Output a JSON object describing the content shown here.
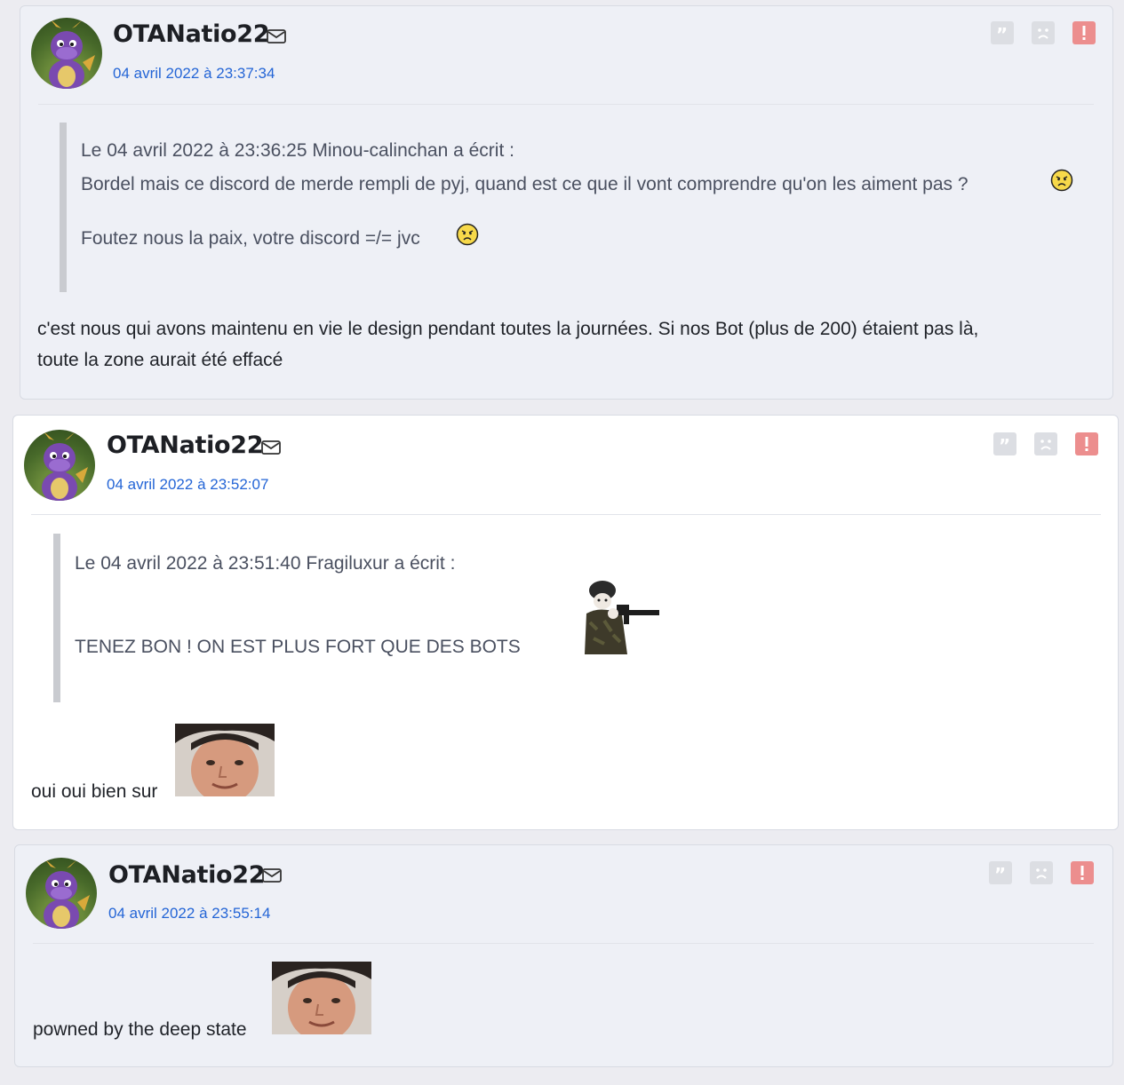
{
  "icons": {
    "mail": "mail-icon",
    "quote": "quote-icon",
    "blacklist": "sad-face-icon",
    "report": "exclamation-icon",
    "avatar": "purple-dragon-avatar",
    "smiley": "angry-smiley-icon",
    "soldier": "soldier-sticker",
    "face": "man-face-sticker"
  },
  "colors": {
    "date_link": "#2465d6",
    "report_red": "#ec8e8e",
    "quote_bar": "#c9cbd0"
  },
  "posts": [
    {
      "author": "OTANatio22",
      "date": "04 avril 2022 à 23:37:34",
      "quote": {
        "header": "Le 04 avril 2022 à 23:36:25 Minou-calinchan a écrit :",
        "line1": "Bordel mais ce discord de merde rempli de pyj, quand est ce que il vont comprendre qu'on les aiment pas ?",
        "line2": "Foutez nous la paix, votre discord =/= jvc"
      },
      "text_line1": "c'est nous qui avons maintenu en vie le design pendant toutes la journées. Si nos Bot (plus de 200) étaient pas là,",
      "text_line2": "toute la zone aurait été effacé"
    },
    {
      "author": "OTANatio22",
      "date": "04 avril 2022 à 23:52:07",
      "quote": {
        "header": "Le 04 avril 2022 à 23:51:40 Fragiluxur a écrit :",
        "line1": "TENEZ BON ! ON EST PLUS FORT QUE DES BOTS"
      },
      "text": "oui oui bien sur"
    },
    {
      "author": "OTANatio22",
      "date": "04 avril 2022 à 23:55:14",
      "text": "powned by the deep state"
    }
  ]
}
